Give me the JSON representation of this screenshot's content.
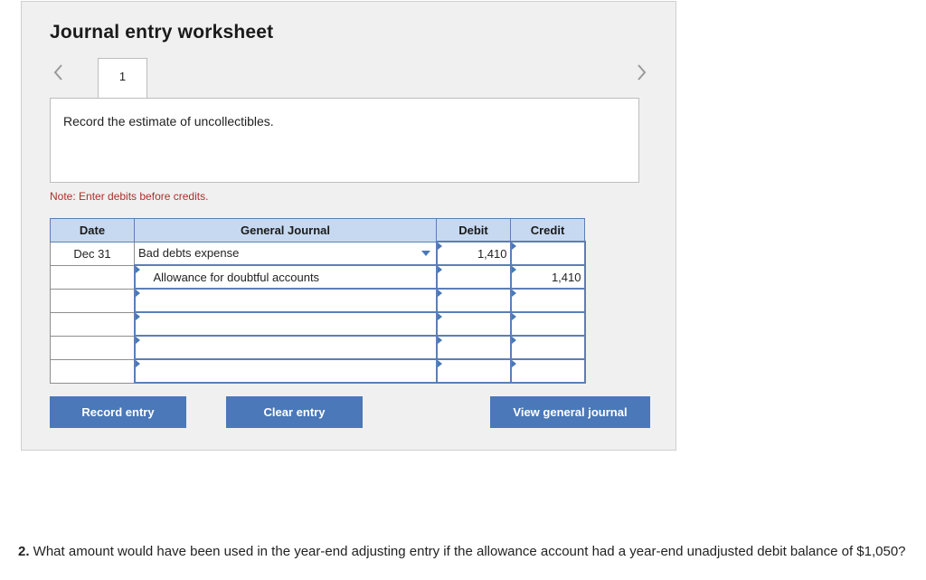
{
  "worksheet": {
    "title": "Journal entry worksheet",
    "tab_label": "1",
    "prompt": "Record the estimate of uncollectibles.",
    "note": "Note: Enter debits before credits."
  },
  "table": {
    "headers": {
      "date": "Date",
      "journal": "General Journal",
      "debit": "Debit",
      "credit": "Credit"
    },
    "rows": [
      {
        "date": "Dec 31",
        "account": "Bad debts expense",
        "debit": "1,410",
        "credit": ""
      },
      {
        "date": "",
        "account": "Allowance for doubtful accounts",
        "debit": "",
        "credit": "1,410"
      },
      {
        "date": "",
        "account": "",
        "debit": "",
        "credit": ""
      },
      {
        "date": "",
        "account": "",
        "debit": "",
        "credit": ""
      },
      {
        "date": "",
        "account": "",
        "debit": "",
        "credit": ""
      },
      {
        "date": "",
        "account": "",
        "debit": "",
        "credit": ""
      }
    ]
  },
  "buttons": {
    "record": "Record entry",
    "clear": "Clear entry",
    "view": "View general journal"
  },
  "question": {
    "number": "2.",
    "text": " What amount would have been used in the year-end adjusting entry if the allowance account had a year-end unadjusted debit balance of $1,050?"
  },
  "icons": {
    "prev": "chevron-left-icon",
    "next": "chevron-right-icon",
    "dropdown": "caret-down-icon"
  },
  "colors": {
    "accent": "#4a78b8",
    "header_bg": "#c7d9f1",
    "note": "#a8322b"
  }
}
